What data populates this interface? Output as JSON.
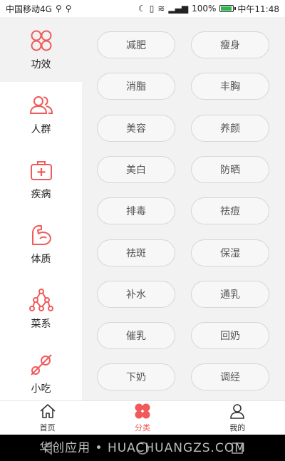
{
  "status": {
    "carrier": "中国移动4G",
    "battery": "100%",
    "time": "中午11:48",
    "battery_level": 1.0
  },
  "sidebar": {
    "items": [
      {
        "label": "功效",
        "icon": "circles-icon"
      },
      {
        "label": "人群",
        "icon": "people-icon"
      },
      {
        "label": "疾病",
        "icon": "medkit-icon"
      },
      {
        "label": "体质",
        "icon": "muscle-icon"
      },
      {
        "label": "菜系",
        "icon": "tree-icon"
      },
      {
        "label": "小吃",
        "icon": "snack-icon"
      }
    ]
  },
  "tags": [
    "减肥",
    "瘦身",
    "消脂",
    "丰胸",
    "美容",
    "养颜",
    "美白",
    "防晒",
    "排毒",
    "祛痘",
    "祛斑",
    "保湿",
    "补水",
    "通乳",
    "催乳",
    "回奶",
    "下奶",
    "调经"
  ],
  "tabbar": {
    "home": "首页",
    "category": "分类",
    "mine": "我的"
  },
  "watermark": "华创应用 • HUACHUANGZS.COM",
  "colors": {
    "accent": "#f05a5a",
    "panel": "#f2f2f2"
  }
}
